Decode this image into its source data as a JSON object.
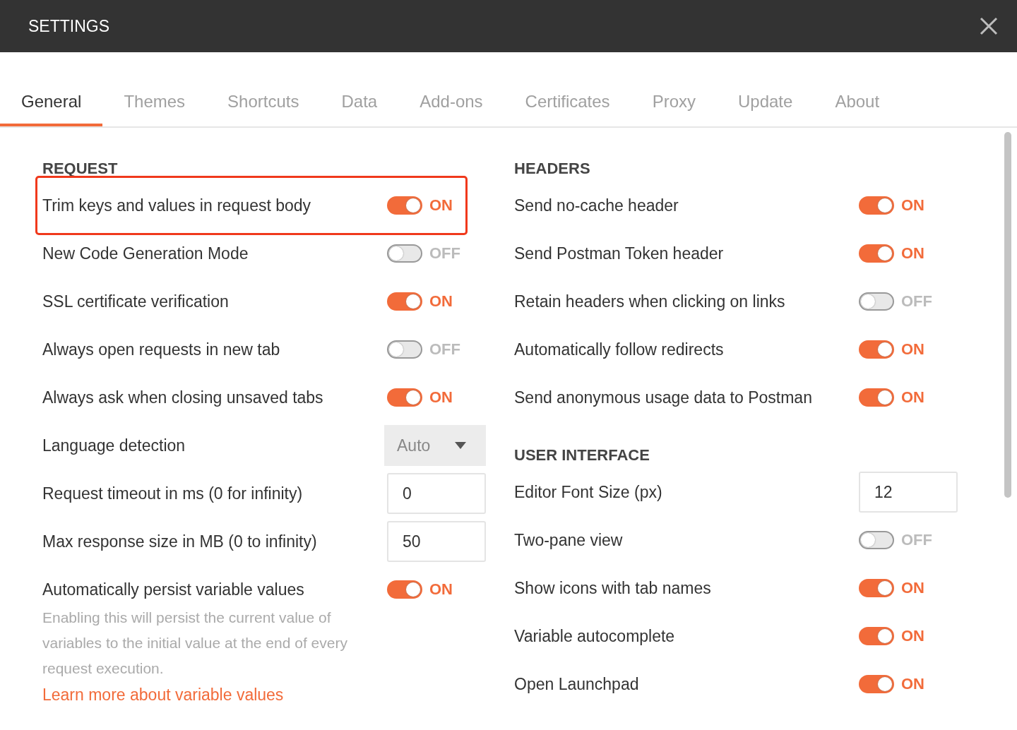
{
  "window": {
    "title": "SETTINGS"
  },
  "tabs": [
    {
      "label": "General",
      "selected": true
    },
    {
      "label": "Themes",
      "selected": false
    },
    {
      "label": "Shortcuts",
      "selected": false
    },
    {
      "label": "Data",
      "selected": false
    },
    {
      "label": "Add-ons",
      "selected": false
    },
    {
      "label": "Certificates",
      "selected": false
    },
    {
      "label": "Proxy",
      "selected": false
    },
    {
      "label": "Update",
      "selected": false
    },
    {
      "label": "About",
      "selected": false
    }
  ],
  "columns": [
    {
      "items": [
        {
          "kind": "heading",
          "label": "REQUEST"
        },
        {
          "kind": "toggle",
          "label": "Trim keys and values in request body",
          "on": true,
          "state": "ON",
          "highlighted": true
        },
        {
          "kind": "toggle",
          "label": "New Code Generation Mode",
          "on": false,
          "state": "OFF",
          "highlighted": false
        },
        {
          "kind": "toggle",
          "label": "SSL certificate verification",
          "on": true,
          "state": "ON",
          "highlighted": false
        },
        {
          "kind": "toggle",
          "label": "Always open requests in new tab",
          "on": false,
          "state": "OFF",
          "highlighted": false
        },
        {
          "kind": "toggle",
          "label": "Always ask when closing unsaved tabs",
          "on": true,
          "state": "ON",
          "highlighted": false
        },
        {
          "kind": "select",
          "label": "Language detection",
          "value": "Auto"
        },
        {
          "kind": "number",
          "label": "Request timeout in ms (0 for infinity)",
          "value": "0"
        },
        {
          "kind": "number",
          "label": "Max response size in MB (0 to infinity)",
          "value": "50"
        },
        {
          "kind": "toggle",
          "label": "Automatically persist variable values",
          "on": true,
          "state": "ON",
          "highlighted": false,
          "description": "Enabling this will persist the current value of variables to the initial value at the end of every request execution.",
          "link": "Learn more about variable values"
        }
      ]
    },
    {
      "items": [
        {
          "kind": "heading",
          "label": "HEADERS"
        },
        {
          "kind": "toggle",
          "label": "Send no-cache header",
          "on": true,
          "state": "ON",
          "highlighted": false
        },
        {
          "kind": "toggle",
          "label": "Send Postman Token header",
          "on": true,
          "state": "ON",
          "highlighted": false
        },
        {
          "kind": "toggle",
          "label": "Retain headers when clicking on links",
          "on": false,
          "state": "OFF",
          "highlighted": false
        },
        {
          "kind": "toggle",
          "label": "Automatically follow redirects",
          "on": true,
          "state": "ON",
          "highlighted": false
        },
        {
          "kind": "toggle",
          "label": "Send anonymous usage data to Postman",
          "on": true,
          "state": "ON",
          "highlighted": false
        },
        {
          "kind": "heading",
          "label": "USER INTERFACE"
        },
        {
          "kind": "number",
          "label": "Editor Font Size (px)",
          "value": "12"
        },
        {
          "kind": "toggle",
          "label": "Two-pane view",
          "on": false,
          "state": "OFF",
          "highlighted": false
        },
        {
          "kind": "toggle",
          "label": "Show icons with tab names",
          "on": true,
          "state": "ON",
          "highlighted": false
        },
        {
          "kind": "toggle",
          "label": "Variable autocomplete",
          "on": true,
          "state": "ON",
          "highlighted": false
        },
        {
          "kind": "toggle",
          "label": "Open Launchpad",
          "on": true,
          "state": "ON",
          "highlighted": false
        }
      ]
    }
  ]
}
